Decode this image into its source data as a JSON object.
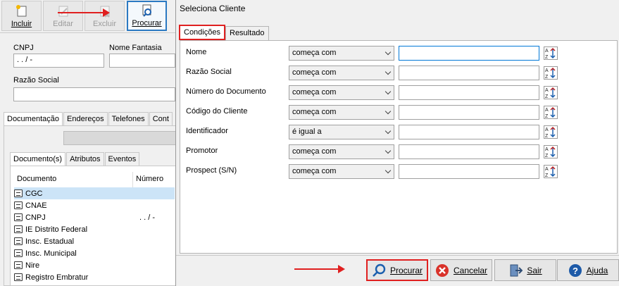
{
  "toolbar": {
    "incluir": "Incluir",
    "editar": "Editar",
    "excluir": "Excluir",
    "procurar": "Procurar"
  },
  "form": {
    "cnpj_label": "CNPJ",
    "cnpj_value": " .  .  /  -",
    "nome_fantasia_label": "Nome Fantasia",
    "razao_social_label": "Razão Social"
  },
  "main_tabs": [
    "Documentação",
    "Endereços",
    "Telefones",
    "Cont"
  ],
  "sub_tabs": [
    "Documento(s)",
    "Atributos",
    "Eventos"
  ],
  "doc_table": {
    "col_documento": "Documento",
    "col_numero": "Número",
    "rows": [
      {
        "label": "CGC",
        "numero": ""
      },
      {
        "label": "CNAE",
        "numero": ""
      },
      {
        "label": "CNPJ",
        "numero": " .  .  /  -"
      },
      {
        "label": "IE Distrito Federal",
        "numero": ""
      },
      {
        "label": "Insc. Estadual",
        "numero": ""
      },
      {
        "label": "Insc. Municipal",
        "numero": ""
      },
      {
        "label": "Nire",
        "numero": ""
      },
      {
        "label": "Registro Embratur",
        "numero": ""
      }
    ]
  },
  "dialog": {
    "title": "Seleciona Cliente",
    "tabs": [
      "Condições",
      "Resultado"
    ],
    "conditions": [
      {
        "label": "Nome",
        "operator": "começa com",
        "value": ""
      },
      {
        "label": "Razão Social",
        "operator": "começa com",
        "value": ""
      },
      {
        "label": "Número do Documento",
        "operator": "começa com",
        "value": ""
      },
      {
        "label": "Código do Cliente",
        "operator": "começa com",
        "value": ""
      },
      {
        "label": "Identificador",
        "operator": "é igual a",
        "value": ""
      },
      {
        "label": "Promotor",
        "operator": "começa com",
        "value": ""
      },
      {
        "label": "Prospect (S/N)",
        "operator": "começa com",
        "value": ""
      }
    ],
    "buttons": {
      "procurar": "Procurar",
      "cancelar": "Cancelar",
      "sair": "Sair",
      "ajuda": "Ajuda"
    }
  },
  "colors": {
    "highlight": "#e02020",
    "selection": "#cce4f7",
    "focus": "#0078d7"
  }
}
